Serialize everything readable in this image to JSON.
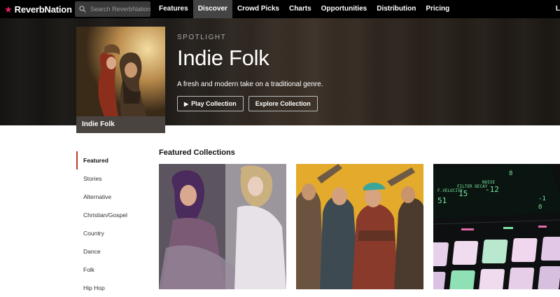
{
  "brand": {
    "name": "ReverbNation",
    "accent": "#e2236a"
  },
  "search": {
    "placeholder": "Search ReverbNation",
    "icon": "search-icon"
  },
  "nav": {
    "items": [
      {
        "label": "Features",
        "active": false
      },
      {
        "label": "Discover",
        "active": true
      },
      {
        "label": "Crowd Picks",
        "active": false
      },
      {
        "label": "Charts",
        "active": false
      },
      {
        "label": "Opportunities",
        "active": false
      },
      {
        "label": "Distribution",
        "active": false
      },
      {
        "label": "Pricing",
        "active": false
      }
    ],
    "edge_label": "L"
  },
  "hero": {
    "eyebrow": "SPOTLIGHT",
    "title": "Indie Folk",
    "subtitle": "A fresh and modern take on a traditional genre.",
    "play_label": "Play Collection",
    "explore_label": "Explore Collection",
    "cover_caption": "Indie Folk"
  },
  "genres": [
    {
      "label": "Featured",
      "active": true
    },
    {
      "label": "Stories",
      "active": false
    },
    {
      "label": "Alternative",
      "active": false
    },
    {
      "label": "Christian/Gospel",
      "active": false
    },
    {
      "label": "Country",
      "active": false
    },
    {
      "label": "Dance",
      "active": false
    },
    {
      "label": "Folk",
      "active": false
    },
    {
      "label": "Hip Hop",
      "active": false
    }
  ],
  "featured": {
    "title": "Featured Collections",
    "cards": [
      {
        "name": "collection-card-1"
      },
      {
        "name": "collection-card-2"
      },
      {
        "name": "collection-card-3"
      }
    ],
    "synth_readouts": {
      "filter_velocity": "F.VELOCITY",
      "filter_decay": "FILTER DECAY",
      "noise": "NOISE",
      "val_a": "51",
      "val_b": "15",
      "val_c": "-12",
      "val_d": "8",
      "val_e": "-1",
      "val_f": "0"
    }
  }
}
